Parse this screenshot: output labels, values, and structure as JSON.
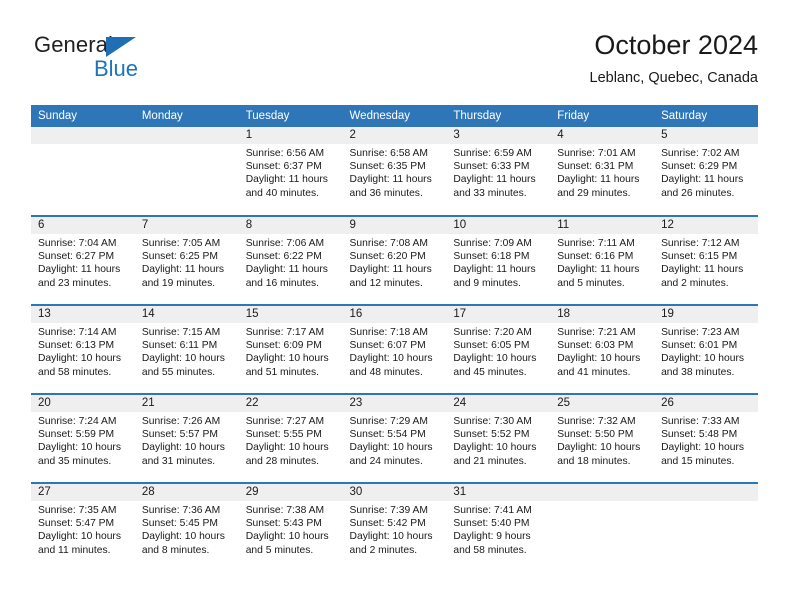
{
  "brand": {
    "name_primary": "General",
    "name_secondary": "Blue",
    "triangle_icon": "triangle-icon",
    "accent_color": "#1b75bc"
  },
  "header": {
    "month_title": "October 2024",
    "location": "Leblanc, Quebec, Canada"
  },
  "calendar": {
    "header_color": "#2f76b8",
    "daynum_band_color": "#efefef",
    "weekday_headers": [
      "Sunday",
      "Monday",
      "Tuesday",
      "Wednesday",
      "Thursday",
      "Friday",
      "Saturday"
    ],
    "weeks": [
      [
        {
          "day": "",
          "empty": true,
          "sunrise": "",
          "sunset": "",
          "daylight_line1": "",
          "daylight_line2": ""
        },
        {
          "day": "",
          "empty": true,
          "sunrise": "",
          "sunset": "",
          "daylight_line1": "",
          "daylight_line2": ""
        },
        {
          "day": "1",
          "empty": false,
          "sunrise": "Sunrise: 6:56 AM",
          "sunset": "Sunset: 6:37 PM",
          "daylight_line1": "Daylight: 11 hours",
          "daylight_line2": "and 40 minutes."
        },
        {
          "day": "2",
          "empty": false,
          "sunrise": "Sunrise: 6:58 AM",
          "sunset": "Sunset: 6:35 PM",
          "daylight_line1": "Daylight: 11 hours",
          "daylight_line2": "and 36 minutes."
        },
        {
          "day": "3",
          "empty": false,
          "sunrise": "Sunrise: 6:59 AM",
          "sunset": "Sunset: 6:33 PM",
          "daylight_line1": "Daylight: 11 hours",
          "daylight_line2": "and 33 minutes."
        },
        {
          "day": "4",
          "empty": false,
          "sunrise": "Sunrise: 7:01 AM",
          "sunset": "Sunset: 6:31 PM",
          "daylight_line1": "Daylight: 11 hours",
          "daylight_line2": "and 29 minutes."
        },
        {
          "day": "5",
          "empty": false,
          "sunrise": "Sunrise: 7:02 AM",
          "sunset": "Sunset: 6:29 PM",
          "daylight_line1": "Daylight: 11 hours",
          "daylight_line2": "and 26 minutes."
        }
      ],
      [
        {
          "day": "6",
          "empty": false,
          "sunrise": "Sunrise: 7:04 AM",
          "sunset": "Sunset: 6:27 PM",
          "daylight_line1": "Daylight: 11 hours",
          "daylight_line2": "and 23 minutes."
        },
        {
          "day": "7",
          "empty": false,
          "sunrise": "Sunrise: 7:05 AM",
          "sunset": "Sunset: 6:25 PM",
          "daylight_line1": "Daylight: 11 hours",
          "daylight_line2": "and 19 minutes."
        },
        {
          "day": "8",
          "empty": false,
          "sunrise": "Sunrise: 7:06 AM",
          "sunset": "Sunset: 6:22 PM",
          "daylight_line1": "Daylight: 11 hours",
          "daylight_line2": "and 16 minutes."
        },
        {
          "day": "9",
          "empty": false,
          "sunrise": "Sunrise: 7:08 AM",
          "sunset": "Sunset: 6:20 PM",
          "daylight_line1": "Daylight: 11 hours",
          "daylight_line2": "and 12 minutes."
        },
        {
          "day": "10",
          "empty": false,
          "sunrise": "Sunrise: 7:09 AM",
          "sunset": "Sunset: 6:18 PM",
          "daylight_line1": "Daylight: 11 hours",
          "daylight_line2": "and 9 minutes."
        },
        {
          "day": "11",
          "empty": false,
          "sunrise": "Sunrise: 7:11 AM",
          "sunset": "Sunset: 6:16 PM",
          "daylight_line1": "Daylight: 11 hours",
          "daylight_line2": "and 5 minutes."
        },
        {
          "day": "12",
          "empty": false,
          "sunrise": "Sunrise: 7:12 AM",
          "sunset": "Sunset: 6:15 PM",
          "daylight_line1": "Daylight: 11 hours",
          "daylight_line2": "and 2 minutes."
        }
      ],
      [
        {
          "day": "13",
          "empty": false,
          "sunrise": "Sunrise: 7:14 AM",
          "sunset": "Sunset: 6:13 PM",
          "daylight_line1": "Daylight: 10 hours",
          "daylight_line2": "and 58 minutes."
        },
        {
          "day": "14",
          "empty": false,
          "sunrise": "Sunrise: 7:15 AM",
          "sunset": "Sunset: 6:11 PM",
          "daylight_line1": "Daylight: 10 hours",
          "daylight_line2": "and 55 minutes."
        },
        {
          "day": "15",
          "empty": false,
          "sunrise": "Sunrise: 7:17 AM",
          "sunset": "Sunset: 6:09 PM",
          "daylight_line1": "Daylight: 10 hours",
          "daylight_line2": "and 51 minutes."
        },
        {
          "day": "16",
          "empty": false,
          "sunrise": "Sunrise: 7:18 AM",
          "sunset": "Sunset: 6:07 PM",
          "daylight_line1": "Daylight: 10 hours",
          "daylight_line2": "and 48 minutes."
        },
        {
          "day": "17",
          "empty": false,
          "sunrise": "Sunrise: 7:20 AM",
          "sunset": "Sunset: 6:05 PM",
          "daylight_line1": "Daylight: 10 hours",
          "daylight_line2": "and 45 minutes."
        },
        {
          "day": "18",
          "empty": false,
          "sunrise": "Sunrise: 7:21 AM",
          "sunset": "Sunset: 6:03 PM",
          "daylight_line1": "Daylight: 10 hours",
          "daylight_line2": "and 41 minutes."
        },
        {
          "day": "19",
          "empty": false,
          "sunrise": "Sunrise: 7:23 AM",
          "sunset": "Sunset: 6:01 PM",
          "daylight_line1": "Daylight: 10 hours",
          "daylight_line2": "and 38 minutes."
        }
      ],
      [
        {
          "day": "20",
          "empty": false,
          "sunrise": "Sunrise: 7:24 AM",
          "sunset": "Sunset: 5:59 PM",
          "daylight_line1": "Daylight: 10 hours",
          "daylight_line2": "and 35 minutes."
        },
        {
          "day": "21",
          "empty": false,
          "sunrise": "Sunrise: 7:26 AM",
          "sunset": "Sunset: 5:57 PM",
          "daylight_line1": "Daylight: 10 hours",
          "daylight_line2": "and 31 minutes."
        },
        {
          "day": "22",
          "empty": false,
          "sunrise": "Sunrise: 7:27 AM",
          "sunset": "Sunset: 5:55 PM",
          "daylight_line1": "Daylight: 10 hours",
          "daylight_line2": "and 28 minutes."
        },
        {
          "day": "23",
          "empty": false,
          "sunrise": "Sunrise: 7:29 AM",
          "sunset": "Sunset: 5:54 PM",
          "daylight_line1": "Daylight: 10 hours",
          "daylight_line2": "and 24 minutes."
        },
        {
          "day": "24",
          "empty": false,
          "sunrise": "Sunrise: 7:30 AM",
          "sunset": "Sunset: 5:52 PM",
          "daylight_line1": "Daylight: 10 hours",
          "daylight_line2": "and 21 minutes."
        },
        {
          "day": "25",
          "empty": false,
          "sunrise": "Sunrise: 7:32 AM",
          "sunset": "Sunset: 5:50 PM",
          "daylight_line1": "Daylight: 10 hours",
          "daylight_line2": "and 18 minutes."
        },
        {
          "day": "26",
          "empty": false,
          "sunrise": "Sunrise: 7:33 AM",
          "sunset": "Sunset: 5:48 PM",
          "daylight_line1": "Daylight: 10 hours",
          "daylight_line2": "and 15 minutes."
        }
      ],
      [
        {
          "day": "27",
          "empty": false,
          "sunrise": "Sunrise: 7:35 AM",
          "sunset": "Sunset: 5:47 PM",
          "daylight_line1": "Daylight: 10 hours",
          "daylight_line2": "and 11 minutes."
        },
        {
          "day": "28",
          "empty": false,
          "sunrise": "Sunrise: 7:36 AM",
          "sunset": "Sunset: 5:45 PM",
          "daylight_line1": "Daylight: 10 hours",
          "daylight_line2": "and 8 minutes."
        },
        {
          "day": "29",
          "empty": false,
          "sunrise": "Sunrise: 7:38 AM",
          "sunset": "Sunset: 5:43 PM",
          "daylight_line1": "Daylight: 10 hours",
          "daylight_line2": "and 5 minutes."
        },
        {
          "day": "30",
          "empty": false,
          "sunrise": "Sunrise: 7:39 AM",
          "sunset": "Sunset: 5:42 PM",
          "daylight_line1": "Daylight: 10 hours",
          "daylight_line2": "and 2 minutes."
        },
        {
          "day": "31",
          "empty": false,
          "sunrise": "Sunrise: 7:41 AM",
          "sunset": "Sunset: 5:40 PM",
          "daylight_line1": "Daylight: 9 hours",
          "daylight_line2": "and 58 minutes."
        },
        {
          "day": "",
          "empty": true,
          "sunrise": "",
          "sunset": "",
          "daylight_line1": "",
          "daylight_line2": ""
        },
        {
          "day": "",
          "empty": true,
          "sunrise": "",
          "sunset": "",
          "daylight_line1": "",
          "daylight_line2": ""
        }
      ]
    ]
  }
}
